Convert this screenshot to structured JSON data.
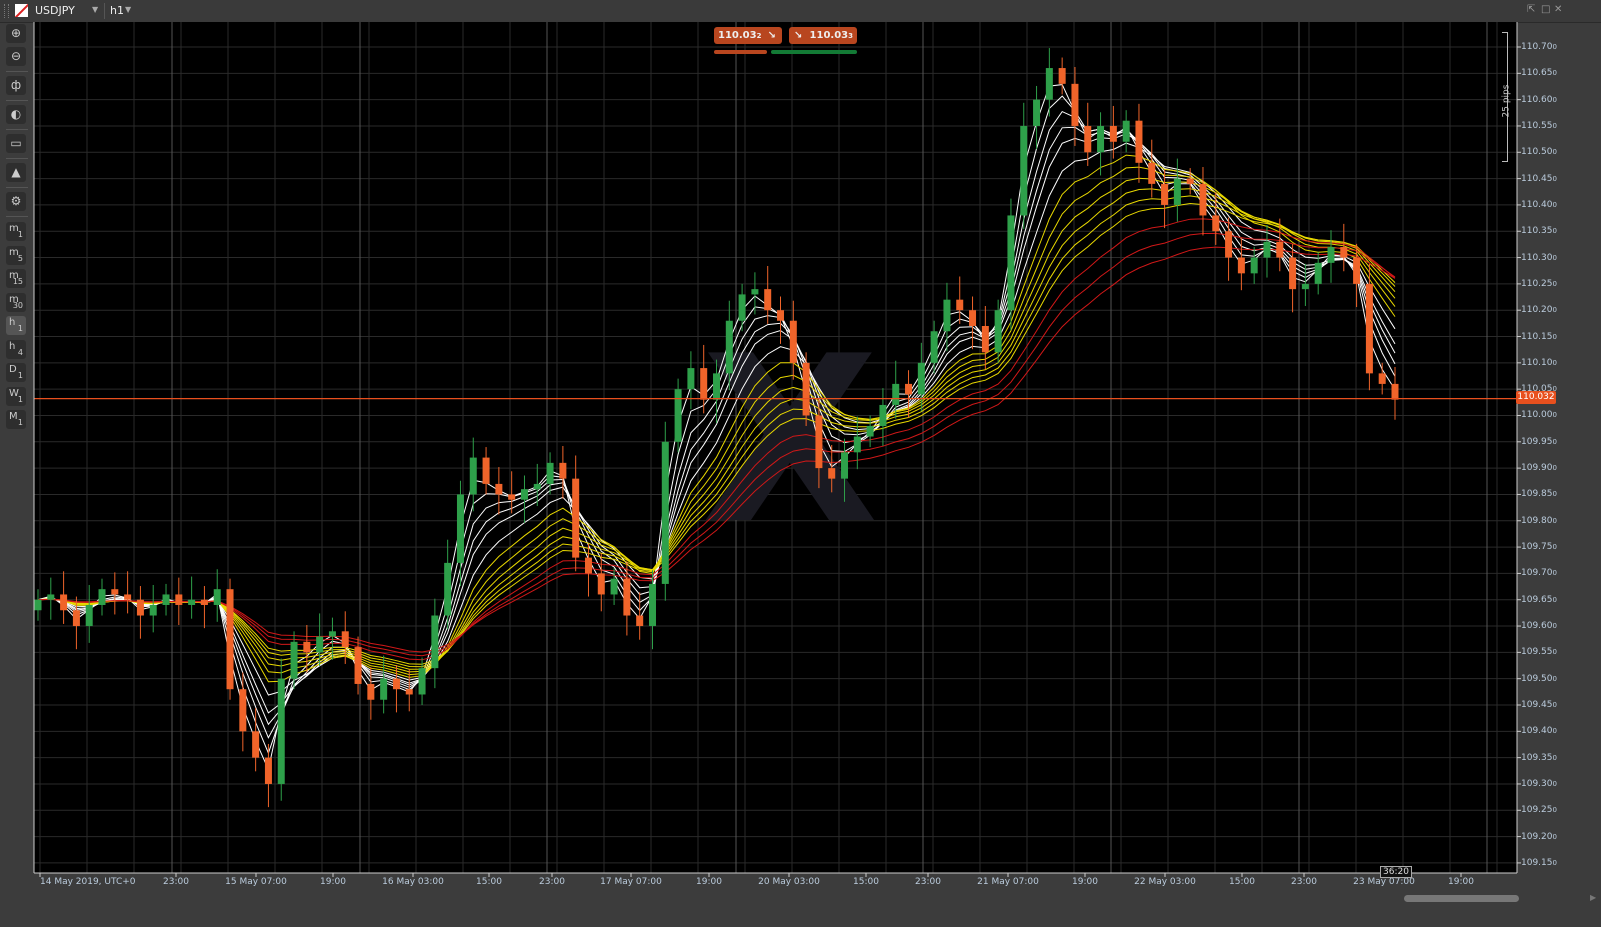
{
  "header": {
    "symbol": "USDJPY",
    "timeframe": "h1"
  },
  "toolbar": {
    "items": [
      {
        "name": "zoom-in",
        "glyph": "⊕"
      },
      {
        "name": "zoom-out",
        "glyph": "⊖"
      },
      {
        "name": "chart-type",
        "glyph": "ф"
      },
      {
        "name": "sentiment",
        "glyph": "◐"
      },
      {
        "name": "cbots",
        "glyph": "▭"
      },
      {
        "name": "objects",
        "glyph": "▲"
      },
      {
        "name": "chart-settings",
        "glyph": "⚙"
      }
    ],
    "timeframes": [
      {
        "a": "m",
        "b": "1"
      },
      {
        "a": "m",
        "b": "5"
      },
      {
        "a": "m",
        "b": "15"
      },
      {
        "a": "m",
        "b": "30"
      },
      {
        "a": "h",
        "b": "1"
      },
      {
        "a": "h",
        "b": "4"
      },
      {
        "a": "D",
        "b": "1"
      },
      {
        "a": "W",
        "b": "1"
      },
      {
        "a": "M",
        "b": "1"
      }
    ]
  },
  "trade": {
    "sell_price": "110.03",
    "sell_pipette": "2",
    "buy_price": "110.03",
    "buy_pipette": "3"
  },
  "ruler_label": "25 pips",
  "current_price": "110.032",
  "countdown": "36:20",
  "colors": {
    "bull": "#2ea04a",
    "bear": "#f0642a",
    "price_line": "#e8501e",
    "ema_short": "#ffffff",
    "ema_mid": "#e8d800",
    "ema_long": "#d01818"
  },
  "chart_data": {
    "type": "candlestick",
    "title": "USDJPY h1",
    "interval_per_candle": "2h (approx.)",
    "first_open": 109.63,
    "closes": [
      109.65,
      109.66,
      109.63,
      109.6,
      109.64,
      109.67,
      109.66,
      109.65,
      109.62,
      109.64,
      109.66,
      109.64,
      109.65,
      109.64,
      109.67,
      109.48,
      109.4,
      109.35,
      109.3,
      109.5,
      109.57,
      109.55,
      109.58,
      109.59,
      109.56,
      109.49,
      109.46,
      109.5,
      109.48,
      109.47,
      109.52,
      109.62,
      109.72,
      109.85,
      109.92,
      109.87,
      109.85,
      109.84,
      109.86,
      109.87,
      109.91,
      109.88,
      109.73,
      109.7,
      109.66,
      109.69,
      109.62,
      109.6,
      109.68,
      109.95,
      110.05,
      110.09,
      110.03,
      110.08,
      110.18,
      110.23,
      110.24,
      110.2,
      110.18,
      110.1,
      110.0,
      109.9,
      109.88,
      109.93,
      109.96,
      109.98,
      110.02,
      110.06,
      110.04,
      110.1,
      110.16,
      110.22,
      110.2,
      110.17,
      110.12,
      110.2,
      110.38,
      110.55,
      110.6,
      110.66,
      110.63,
      110.55,
      110.5,
      110.55,
      110.52,
      110.56,
      110.48,
      110.44,
      110.4,
      110.45,
      110.44,
      110.38,
      110.35,
      110.3,
      110.27,
      110.3,
      110.33,
      110.3,
      110.24,
      110.25,
      110.29,
      110.32,
      110.3,
      110.25,
      110.08,
      110.06,
      110.03
    ],
    "ema_periods": {
      "short": [
        2,
        3,
        4,
        5,
        6,
        8
      ],
      "mid": [
        10,
        12,
        14,
        16,
        18,
        20
      ],
      "long": [
        24,
        28,
        32
      ]
    },
    "ylim": [
      109.13,
      110.72
    ],
    "y_ticks": [
      "110.70",
      "110.65",
      "110.60",
      "110.55",
      "110.50",
      "110.45",
      "110.40",
      "110.35",
      "110.30",
      "110.25",
      "110.20",
      "110.15",
      "110.10",
      "110.05",
      "110.00",
      "109.95",
      "109.90",
      "109.85",
      "109.80",
      "109.75",
      "109.70",
      "109.65",
      "109.60",
      "109.55",
      "109.50",
      "109.45",
      "109.40",
      "109.35",
      "109.30",
      "109.25",
      "109.20",
      "109.15"
    ],
    "x_ticks": [
      "14 May 2019, UTC+0",
      "23:00",
      "15 May 07:00",
      "19:00",
      "16 May 03:00",
      "15:00",
      "23:00",
      "17 May 07:00",
      "19:00",
      "20 May 03:00",
      "15:00",
      "23:00",
      "21 May 07:00",
      "19:00",
      "22 May 03:00",
      "15:00",
      "23:00",
      "23 May 07:00",
      "19:00"
    ],
    "current_price": 110.032
  }
}
